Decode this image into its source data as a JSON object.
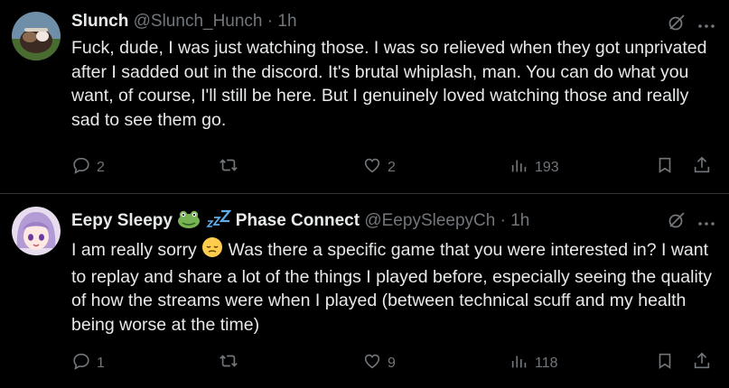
{
  "tweets": [
    {
      "name": "Slunch",
      "handle": "@Slunch_Hunch",
      "time": "· 1h",
      "text": "Fuck, dude, I was just watching those. I was so relieved when they got unprivated after I sadded out in the discord. It's brutal whiplash, man. You can do what you want, of course, I'll still be here. But I genuinely loved watching those and really sad to see them go.",
      "replies": "2",
      "retweets": "",
      "likes": "2",
      "views": "193"
    },
    {
      "name_prefix": "Eepy Sleepy",
      "name_suffix": "Phase Connect",
      "handle": "@EepySleepyCh",
      "time": "· 1h",
      "text_start": "I am really sorry",
      "text_rest": "Was there a specific game that you were interested in? I want to replay and share a lot of the things I played before, especially seeing the quality of how the streams were when I played (between technical scuff and my health being worse at the time)",
      "replies": "1",
      "retweets": "",
      "likes": "9",
      "views": "118"
    }
  ],
  "icons": [
    "grok-icon",
    "more-icon",
    "reply-icon",
    "retweet-icon",
    "like-icon",
    "views-icon",
    "bookmark-icon",
    "share-icon"
  ],
  "colors": {
    "background": "#000000",
    "text": "#e7e9ea",
    "muted": "#71767b",
    "divider": "#2f3336"
  }
}
